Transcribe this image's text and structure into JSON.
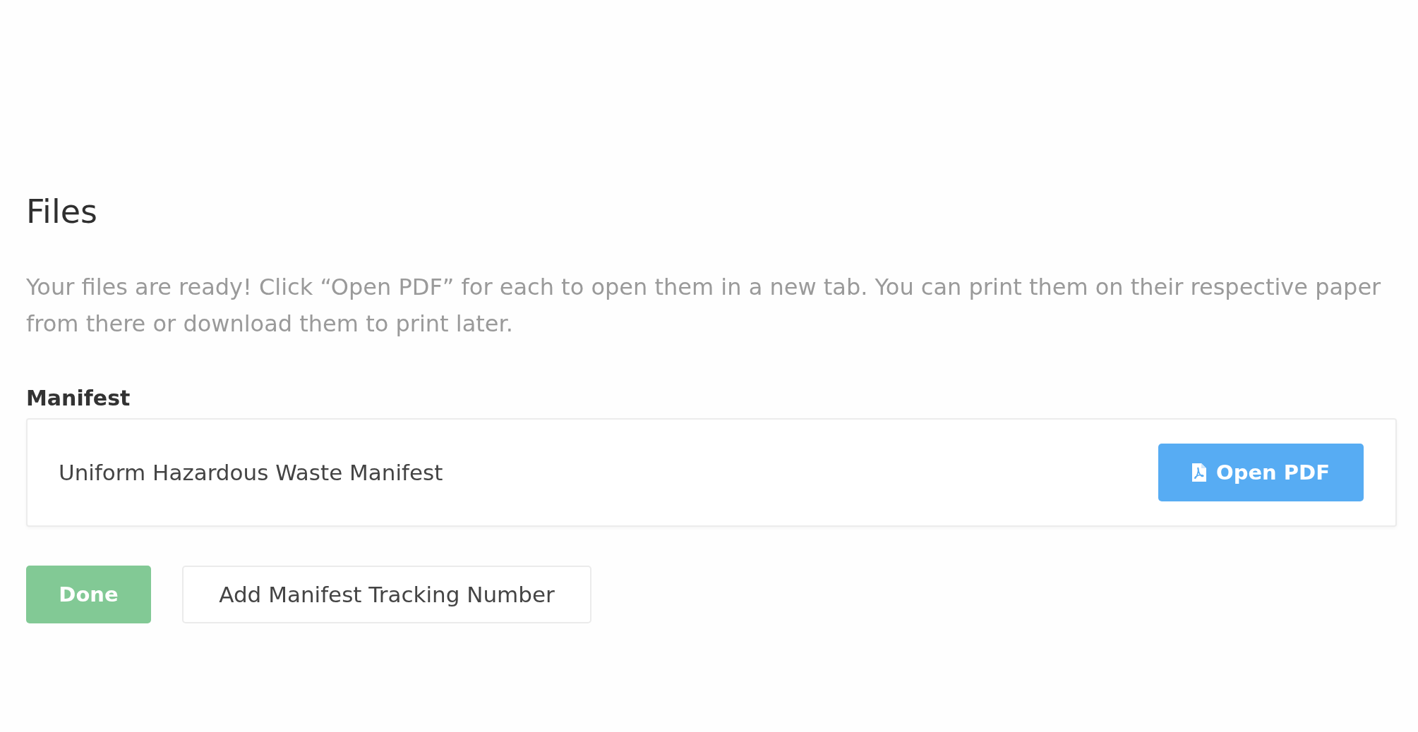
{
  "dialog": {
    "title": "Files",
    "description": "Your files are ready! Click “Open PDF” for each to open them in a new tab. You can print them on their respective paper from there or download them to print later.",
    "sections": [
      {
        "label": "Manifest",
        "files": [
          {
            "name": "Uniform Hazardous Waste Manifest",
            "action": "Open PDF"
          }
        ]
      }
    ],
    "buttons": [
      {
        "label": "Done",
        "kind": "primary"
      },
      {
        "label": "Add Manifest Tracking Number",
        "kind": "secondary"
      }
    ]
  }
}
